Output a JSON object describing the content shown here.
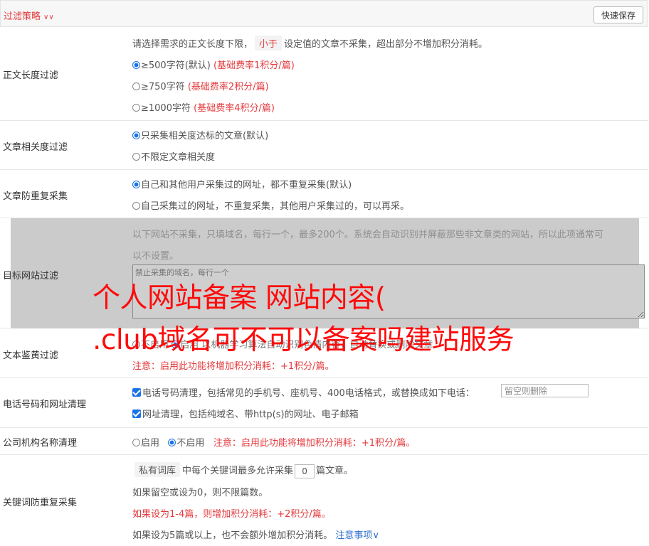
{
  "header": {
    "title": "过滤策略",
    "save_label": "快速保存"
  },
  "length_filter": {
    "label": "正文长度过滤",
    "intro_prefix": "请选择需求的正文长度下限，",
    "intro_tag": "小于",
    "intro_suffix": "设定值的文章不采集，超出部分不增加积分消耗。",
    "options": [
      {
        "text": "≥500字符(默认)",
        "note": "(基础费率1积分/篇)",
        "checked": true
      },
      {
        "text": "≥750字符",
        "note": "(基础费率2积分/篇)",
        "checked": false
      },
      {
        "text": "≥1000字符",
        "note": "(基础费率4积分/篇)",
        "checked": false
      }
    ]
  },
  "relevance_filter": {
    "label": "文章相关度过滤",
    "options": [
      {
        "text": "只采集相关度达标的文章(默认)",
        "checked": true
      },
      {
        "text": "不限定文章相关度",
        "checked": false
      }
    ]
  },
  "dup_filter": {
    "label": "文章防重复采集",
    "options": [
      {
        "text": "自己和其他用户采集过的网址，都不重复采集(默认)",
        "checked": true
      },
      {
        "text": "自己采集过的网址，不重复采集，其他用户采集过的，可以再采。",
        "checked": false
      }
    ]
  },
  "site_filter": {
    "label": "目标网站过滤",
    "desc_line1": "以下网站不采集，只填域名，每行一个，最多200个。系统会自动识别并屏蔽那些非文章类的网站，所以此项通常可",
    "desc_line2": "以不设置。",
    "placeholder": "禁止采集的域名，每行一个"
  },
  "porn_filter": {
    "label": "文本鉴黄过滤",
    "opt_off": "不启用",
    "opt_on": "启用",
    "desc": "以机器学习算法自动识别色情内容，自动替换或删除文章",
    "note": "注意：启用此功能将增加积分消耗：+1积分/篇。"
  },
  "phone_filter": {
    "label": "电话号码和网址清理",
    "phone_text": "电话号码清理，包括常见的手机号、座机号、400电话格式，或替换成如下电话：",
    "phone_placeholder": "留空则删除",
    "url_text": "网址清理，包括纯域名、带http(s)的网址、电子邮箱"
  },
  "company_filter": {
    "label": "公司机构名称清理",
    "opt_on": "启用",
    "opt_off": "不启用",
    "note": "注意：启用此功能将增加积分消耗：+1积分/篇。"
  },
  "keyword_filter": {
    "label": "关键词防重复采集",
    "tag": "私有词库",
    "line1_mid": "中每个关键词最多允许采集",
    "count": "0",
    "line1_suffix": "篇文章。",
    "line2": "如果留空或设为0，则不限篇数。",
    "line3": "如果设为1-4篇，则增加积分消耗：+2积分/篇。",
    "line4": "如果设为5篇或以上，也不会额外增加积分消耗。",
    "notice_link": "注意事项"
  },
  "watermark": {
    "line1": "个人网站备案 网站内容(",
    "line2": ".club域名可不可以备案吗建站服务",
    "color": "#ff0a0a"
  },
  "colors": {
    "accent": "#e4393c",
    "link": "#2f6fce",
    "check": "#1a73e8"
  }
}
